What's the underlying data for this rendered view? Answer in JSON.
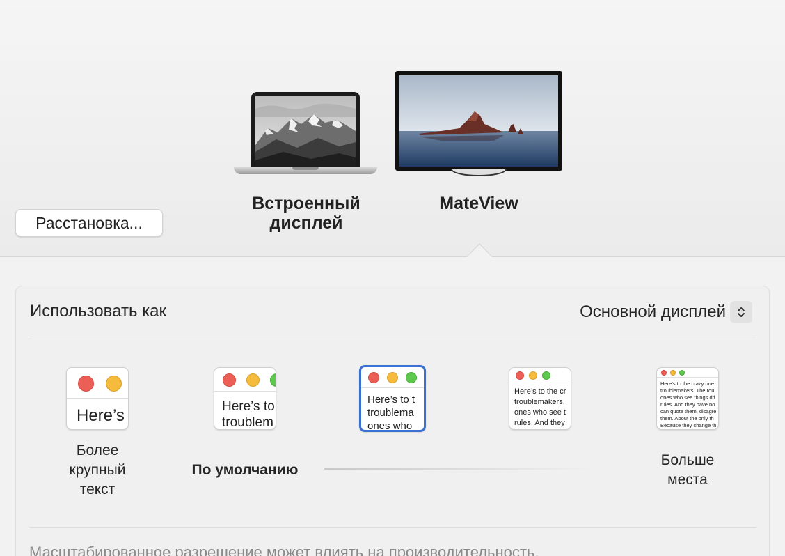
{
  "arrangement": {
    "arrange_button_label": "Расстановка...",
    "displays": [
      {
        "name": "Встроенный дисплей",
        "line1": "Встроенный",
        "line2": "дисплей"
      },
      {
        "name": "MateView"
      }
    ],
    "selected_display": "MateView"
  },
  "settings": {
    "use_as_label": "Использовать как",
    "use_as_value": "Основной дисплей",
    "resolution_options": [
      {
        "label_line1": "Более",
        "label_line2": "крупный",
        "label_line3": "текст",
        "preview_text": "Here’s"
      },
      {
        "label": "По умолчанию",
        "preview_line1": "Here’s to",
        "preview_line2": "troublem"
      },
      {
        "preview_line1": "Here’s to t",
        "preview_line2": "troublema",
        "preview_line3": "ones who",
        "selected": true
      },
      {
        "preview_line1": "Here’s to the cr",
        "preview_line2": "troublemakers.",
        "preview_line3": "ones who see t",
        "preview_line4": "rules. And they"
      },
      {
        "label_line1": "Больше",
        "label_line2": "места",
        "preview_line1": "Here’s to the crazy one",
        "preview_line2": "troublemakers. The rou",
        "preview_line3": "ones who see things dif",
        "preview_line4": "rules. And they have no",
        "preview_line5": "can quote them, disagre",
        "preview_line6": "them. About the only th",
        "preview_line7": "Because they change th"
      }
    ],
    "note": "Масштабированное разрешение может влиять на производительность."
  },
  "colors": {
    "accent": "#3b73d4",
    "traffic_red": "#ec5f57",
    "traffic_yellow": "#f5bb3c",
    "traffic_green": "#5fc94e"
  }
}
